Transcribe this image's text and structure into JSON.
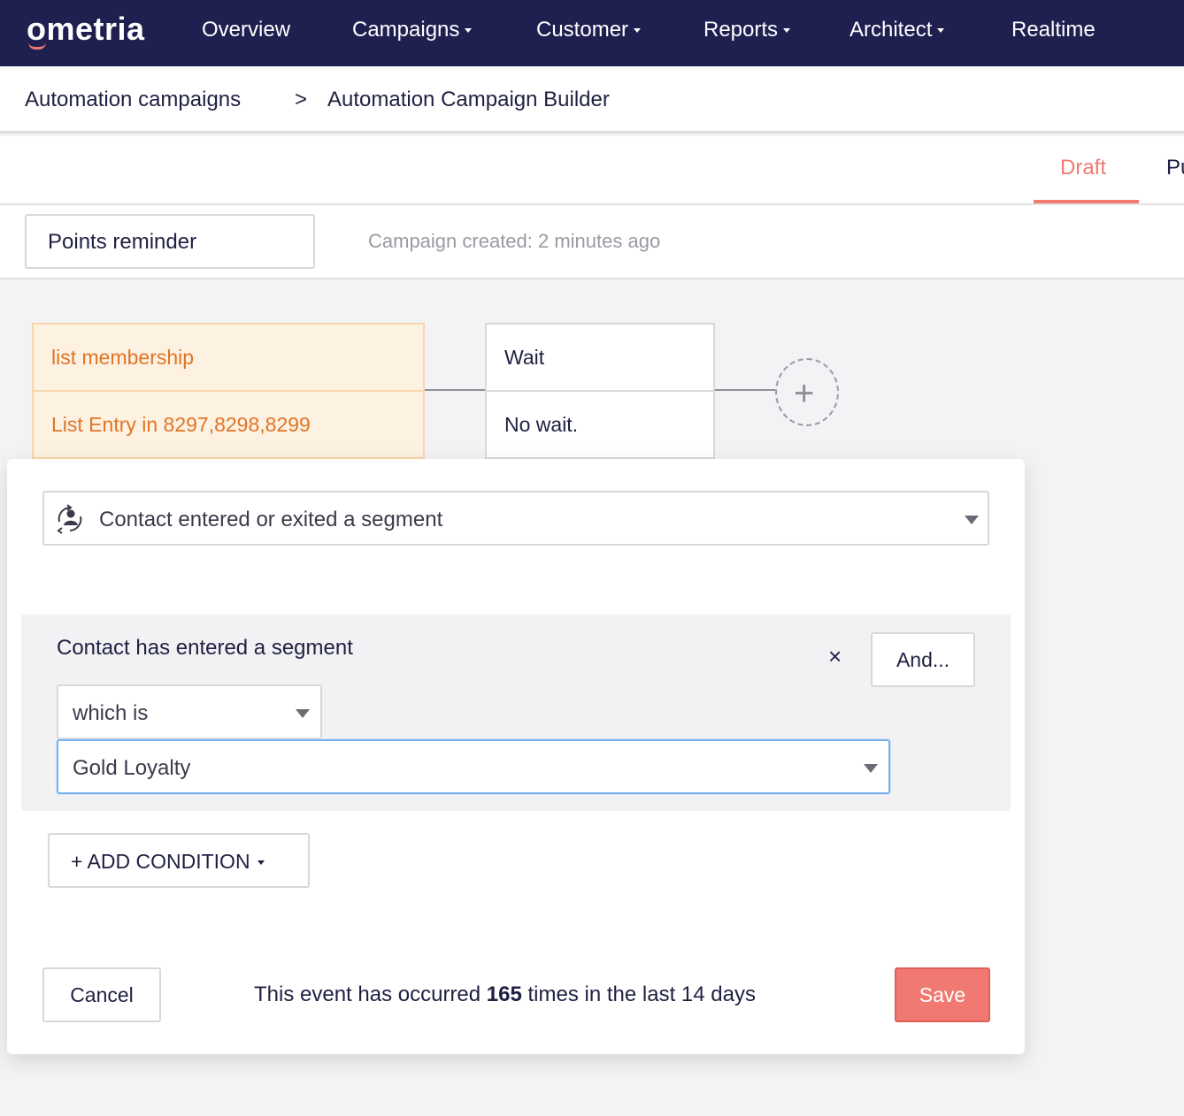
{
  "brand": {
    "logo_text": "ometria",
    "nav_bg": "#1f2050",
    "accent": "#f07a72"
  },
  "nav": {
    "items": [
      {
        "label": "Overview",
        "dropdown": false
      },
      {
        "label": "Campaigns",
        "dropdown": true
      },
      {
        "label": "Customer",
        "dropdown": true
      },
      {
        "label": "Reports",
        "dropdown": true
      },
      {
        "label": "Architect",
        "dropdown": true
      },
      {
        "label": "Realtime",
        "dropdown": false
      }
    ]
  },
  "breadcrumb": {
    "parent": "Automation campaigns",
    "separator": ">",
    "current": "Automation Campaign Builder"
  },
  "status_tabs": {
    "draft": "Draft",
    "published_partial": "Pu",
    "active": "Draft"
  },
  "campaign": {
    "name": "Points reminder",
    "created": "Campaign created: 2 minutes ago"
  },
  "flow": {
    "trigger": {
      "title": "list membership",
      "detail": "List Entry in 8297,8298,8299"
    },
    "wait": {
      "title": "Wait",
      "detail": "No wait."
    },
    "add_icon": "plus-icon"
  },
  "editor": {
    "event_type": "Contact entered or exited a segment",
    "event_icon": "segment-person-icon",
    "condition": {
      "title": "Contact has entered a segment",
      "operator": "which is",
      "segment": "Gold Loyalty",
      "and_label": "And...",
      "remove_symbol": "×"
    },
    "add_condition_label": "+ ADD CONDITION",
    "cancel_label": "Cancel",
    "save_label": "Save",
    "occurrence": {
      "prefix": "This event has occurred",
      "count": "165",
      "suffix": "times in the last 14 days"
    }
  }
}
